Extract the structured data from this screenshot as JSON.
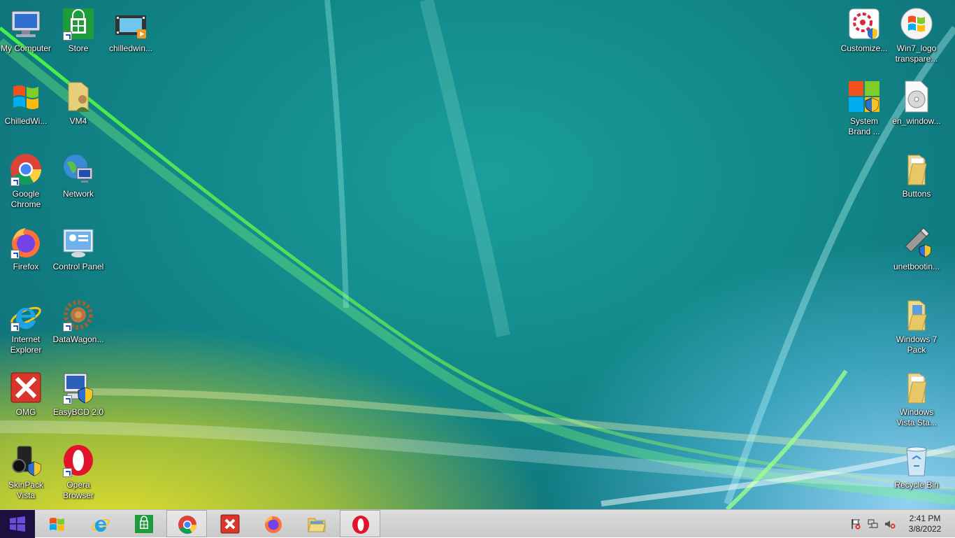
{
  "desktop": {
    "icons_left": [
      {
        "label": "My Computer",
        "icon": "computer-icon"
      },
      {
        "label": "Store",
        "icon": "store-icon"
      },
      {
        "label": "chilledwin...",
        "icon": "video-file-icon"
      },
      {
        "label": "ChilledWi...",
        "icon": "windows-logo-icon"
      },
      {
        "label": "VM4",
        "icon": "folder-user-icon"
      },
      {
        "label": "Google Chrome",
        "icon": "chrome-icon"
      },
      {
        "label": "Network",
        "icon": "network-icon"
      },
      {
        "label": "Firefox",
        "icon": "firefox-icon"
      },
      {
        "label": "Control Panel",
        "icon": "control-panel-icon"
      },
      {
        "label": "Internet Explorer",
        "icon": "internet-explorer-icon"
      },
      {
        "label": "DataWagon...",
        "icon": "gear-icon"
      },
      {
        "label": "OMG",
        "icon": "error-x-icon"
      },
      {
        "label": "EasyBCD 2.0",
        "icon": "easybcd-icon"
      },
      {
        "label": "SkinPack Vista",
        "icon": "skinpack-icon"
      },
      {
        "label": "Opera Browser",
        "icon": "opera-icon"
      }
    ],
    "icons_right": [
      {
        "label": "Customize...",
        "icon": "customize-icon"
      },
      {
        "label": "Win7_logo transpare...",
        "icon": "win7-logo-icon"
      },
      {
        "label": "System Brand ...",
        "icon": "system-brand-icon"
      },
      {
        "label": "en_window...",
        "icon": "disc-image-icon"
      },
      {
        "label": "Buttons",
        "icon": "folder-icon"
      },
      {
        "label": "unetbootin...",
        "icon": "usb-icon"
      },
      {
        "label": "Windows 7 Pack",
        "icon": "folder-icon"
      },
      {
        "label": "Windows Vista Sta...",
        "icon": "folder-icon"
      },
      {
        "label": "Recycle Bin",
        "icon": "recycle-bin-icon"
      }
    ]
  },
  "taskbar": {
    "start_icon": "start-windows-icon",
    "pinned": [
      {
        "icon": "windows-flag-icon",
        "active": false
      },
      {
        "icon": "internet-explorer-icon",
        "active": false
      },
      {
        "icon": "store-icon",
        "active": false
      },
      {
        "icon": "chrome-icon",
        "active": true
      },
      {
        "icon": "error-x-icon",
        "active": false
      },
      {
        "icon": "firefox-icon",
        "active": false
      },
      {
        "icon": "file-explorer-icon",
        "active": false
      },
      {
        "icon": "opera-icon",
        "active": true
      }
    ],
    "tray": [
      "action-center-flag-icon",
      "network-tray-icon",
      "volume-muted-icon"
    ],
    "time": "2:41 PM",
    "date": "3/8/2022"
  },
  "colors": {
    "wallpaper_teal": "#128a8a",
    "wallpaper_yellow": "#e6dc2a",
    "taskbar": "#d2d2d2",
    "start_button": "#1d1040"
  }
}
